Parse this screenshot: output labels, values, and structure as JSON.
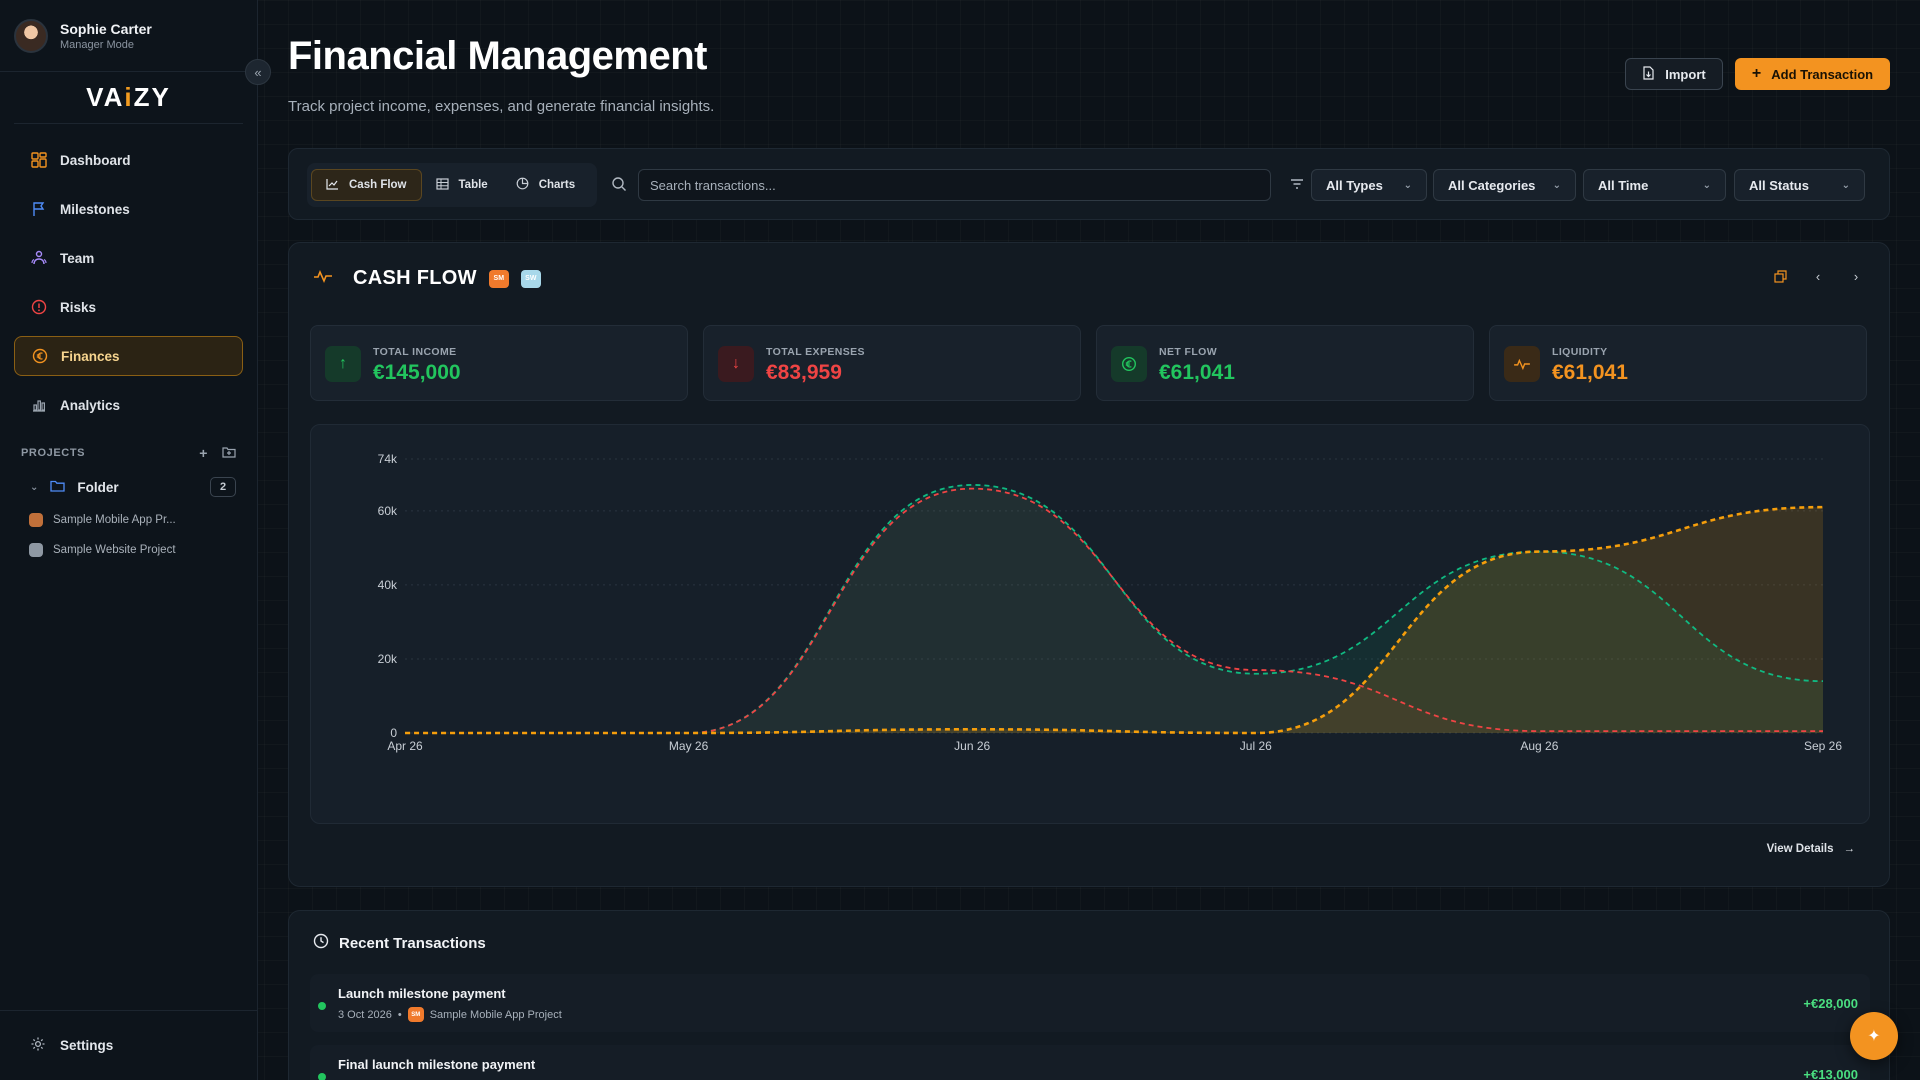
{
  "user": {
    "name": "Sophie Carter",
    "role": "Manager Mode"
  },
  "brand": {
    "logo_pre": "VA",
    "logo_mid": "i",
    "logo_post": "ZY"
  },
  "sidebar": {
    "items": [
      {
        "label": "Dashboard",
        "icon": "dashboard-icon"
      },
      {
        "label": "Milestones",
        "icon": "flag-icon"
      },
      {
        "label": "Team",
        "icon": "team-icon"
      },
      {
        "label": "Risks",
        "icon": "alert-icon"
      },
      {
        "label": "Finances",
        "icon": "euro-icon",
        "active": true
      },
      {
        "label": "Analytics",
        "icon": "bar-chart-icon"
      }
    ],
    "projects_heading": "PROJECTS",
    "folder": {
      "label": "Folder",
      "count": "2"
    },
    "projects": [
      {
        "label": "Sample Mobile App Pr...",
        "color": "#c0703a"
      },
      {
        "label": "Sample Website Project",
        "color": "#8e98a3"
      }
    ],
    "settings_label": "Settings"
  },
  "header": {
    "title": "Financial Management",
    "subtitle": "Track project income, expenses, and generate financial insights.",
    "import_label": "Import",
    "add_label": "Add Transaction"
  },
  "toolbar": {
    "tabs": [
      {
        "label": "Cash Flow",
        "active": true
      },
      {
        "label": "Table"
      },
      {
        "label": "Charts"
      }
    ],
    "search_placeholder": "Search transactions...",
    "filters": [
      "All Types",
      "All Categories",
      "All Time",
      "All Status"
    ]
  },
  "cashflow": {
    "title": "CASH FLOW",
    "badge1": "SM",
    "badge2": "SW",
    "stats": [
      {
        "label": "TOTAL INCOME",
        "value": "€145,000",
        "color": "#22c55e",
        "icon": "arrow-up-icon"
      },
      {
        "label": "TOTAL EXPENSES",
        "value": "€83,959",
        "color": "#ef4444",
        "icon": "arrow-down-icon"
      },
      {
        "label": "NET FLOW",
        "value": "€61,041",
        "color": "#22c55e",
        "icon": "euro-circle-icon"
      },
      {
        "label": "LIQUIDITY",
        "value": "€61,041",
        "color": "#f39320",
        "icon": "activity-icon"
      }
    ],
    "view_details": "View Details"
  },
  "chart_data": {
    "type": "area",
    "x": [
      "Apr 26",
      "May 26",
      "Jun 26",
      "Jul 26",
      "Aug 26",
      "Sep 26"
    ],
    "yticks": [
      "0",
      "20k",
      "40k",
      "60k",
      "74k"
    ],
    "ylim": [
      0,
      74000
    ],
    "grid": true,
    "series": [
      {
        "color": "#10b981",
        "values": [
          0,
          0,
          67000,
          16000,
          49000,
          14000
        ]
      },
      {
        "color": "#ef4444",
        "values": [
          0,
          0,
          66000,
          17000,
          500,
          500
        ]
      },
      {
        "color": "#f59e0b",
        "values": [
          0,
          0,
          1000,
          0,
          49000,
          61000
        ]
      }
    ]
  },
  "recent": {
    "title": "Recent Transactions",
    "items": [
      {
        "name": "Launch milestone payment",
        "date": "3 Oct 2026",
        "project": "Sample Mobile App Project",
        "badge": "SM",
        "amount": "+€28,000"
      },
      {
        "name": "Final launch milestone payment",
        "date": "",
        "project": "",
        "badge": "",
        "amount": "+€13,000"
      }
    ]
  }
}
